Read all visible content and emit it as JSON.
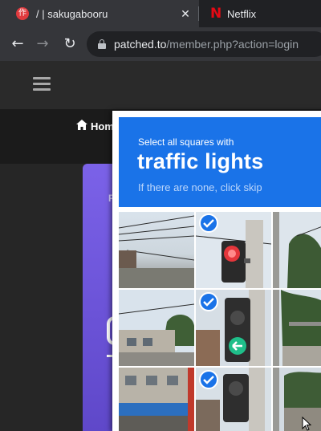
{
  "browser": {
    "tabs": [
      {
        "title": "/ | sakugabooru",
        "favicon": "sakugabooru-icon",
        "close": "✕"
      },
      {
        "title": "Netflix",
        "favicon": "netflix-icon"
      }
    ],
    "url_host": "patched.to",
    "url_path": "/member.php?action=login"
  },
  "site": {
    "nav_home": "Hom",
    "card_letter": "F"
  },
  "captcha": {
    "instruction": "Select all squares with",
    "target": "traffic lights",
    "hint": "If there are none, click skip",
    "selected_tiles": [
      "row1-col2",
      "row2-col2",
      "row3-col2"
    ],
    "accent": "#1a73e8"
  }
}
